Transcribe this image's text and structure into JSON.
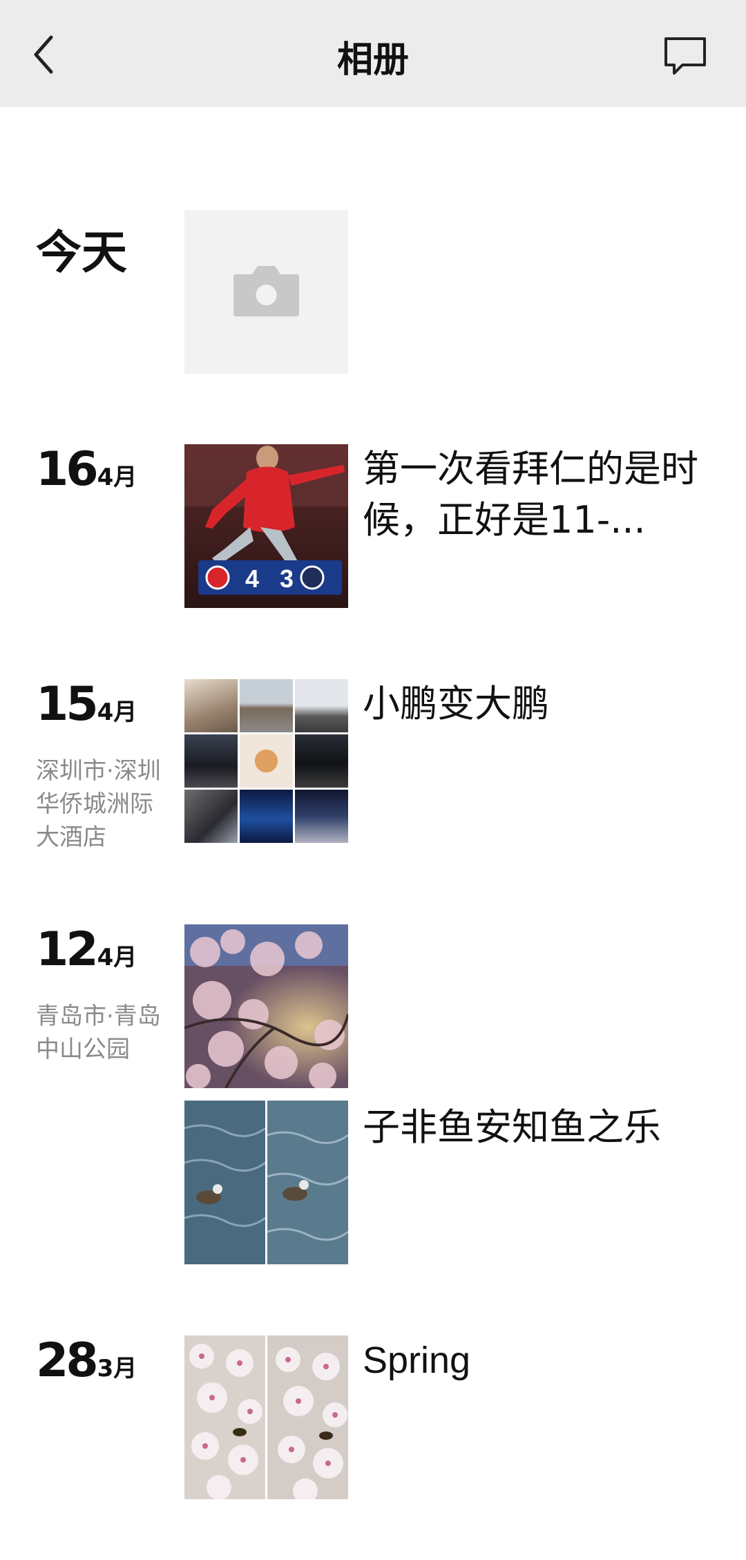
{
  "nav": {
    "back_icon": "chevron-left-icon",
    "title": "相册",
    "message_icon": "message-icon"
  },
  "entries": [
    {
      "day": "今天",
      "upload_icon": "camera-icon"
    },
    {
      "day": "16",
      "month": "4月",
      "caption": "第一次看拜仁的是时候，正好是11-..."
    },
    {
      "day": "15",
      "month": "4月",
      "location": "深圳市·深圳华侨城洲际大酒店",
      "caption": "小鹏变大鹏"
    },
    {
      "day": "12",
      "month": "4月",
      "location": "青岛市·青岛中山公园",
      "caption": "子非鱼安知鱼之乐"
    },
    {
      "day": "28",
      "month": "3月",
      "caption": "Spring"
    }
  ],
  "thumb_texts": {
    "score_home": "4",
    "score_away": "3"
  }
}
